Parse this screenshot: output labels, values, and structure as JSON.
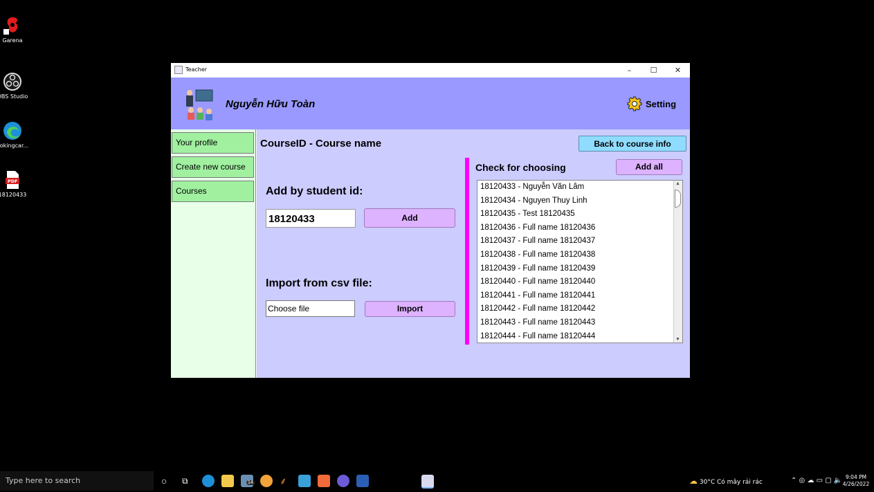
{
  "desktop": {
    "icons": [
      {
        "label": "Garena"
      },
      {
        "label": "OBS Studio"
      },
      {
        "label": "ookingcar..."
      },
      {
        "label": "18120433",
        "badge": "PDF"
      }
    ]
  },
  "window": {
    "title": "Teacher",
    "controls": {
      "minimize": "–",
      "maximize": "☐",
      "close": "✕"
    },
    "header": {
      "username": "Nguyễn Hữu Toàn",
      "setting_label": "Setting"
    },
    "sidebar": {
      "items": [
        {
          "label": "Your profile"
        },
        {
          "label": "Create new course"
        },
        {
          "label": "Courses"
        }
      ]
    },
    "main": {
      "course_title": "CourseID - Course name",
      "back_button": "Back to course info",
      "add_by_id_label": "Add by student id:",
      "student_id_value": "18120433",
      "add_button": "Add",
      "import_label": "Import from csv file:",
      "file_value": "Choose file",
      "import_button": "Import",
      "check_title": "Check for choosing",
      "add_all_button": "Add all",
      "students": [
        "18120433 - Nguyễn Văn Lâm",
        "18120434 - Nguyen Thuy Linh",
        "18120435 - Test 18120435",
        "18120436 - Full name 18120436",
        "18120437 - Full name 18120437",
        "18120438 - Full name 18120438",
        "18120439 - Full name 18120439",
        "18120440 - Full name 18120440",
        "18120441 - Full name 18120441",
        "18120442 - Full name 18120442",
        "18120443 - Full name 18120443",
        "18120444 - Full name 18120444"
      ]
    }
  },
  "taskbar": {
    "search_placeholder": "Type here to search",
    "weather": "30°C  Có mây rải rác",
    "time": "9:04 PM",
    "date": "4/26/2022",
    "edge_badge": "14"
  },
  "colors": {
    "header": "#9999ff",
    "main_bg": "#ccccff",
    "sidebar_bg": "#e8ffe8",
    "sidebar_item": "#a0f0a0",
    "button_purple": "#ddb2ff",
    "button_blue": "#8fdcff",
    "accent_bar": "#ff00ff"
  }
}
